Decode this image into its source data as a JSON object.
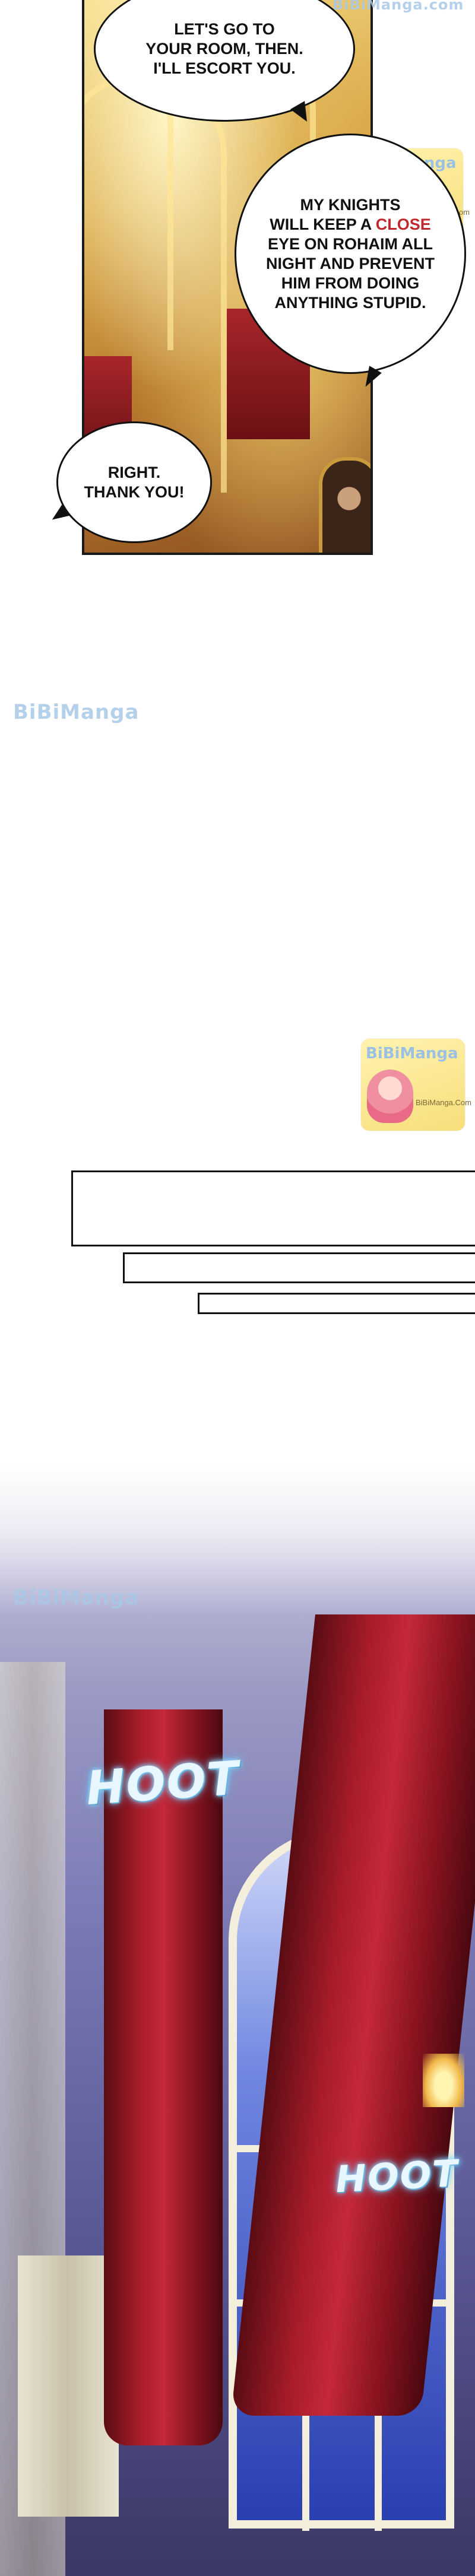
{
  "watermark": {
    "top_right": "BiBiManga.com",
    "mid_left": "BiBiManga",
    "badge_title": "BiBiManga",
    "badge_sub": "BiBiManga.Com",
    "bottom_left": "BiBiManga",
    "small_badge_title": "BiBiManga",
    "small_badge_sub": "BiBiManga.Com"
  },
  "bubbles": {
    "escort": "LET'S GO TO\nYOUR ROOM, THEN.\nI'LL ESCORT YOU.",
    "knights_pre": "MY KNIGHTS\nWILL KEEP A ",
    "knights_red": "CLOSE",
    "knights_post": "\nEYE ON ROHAIM ALL\nNIGHT AND PREVENT\nHIM FROM DOING\nANYTHING STUPID.",
    "thanks": "RIGHT.\nTHANK YOU!"
  },
  "sfx": {
    "hoot_1": "HOOT",
    "hoot_2": "HOOT"
  },
  "colors": {
    "emphasis": "#c0282d",
    "sfx_glow": "#5fc8ff"
  }
}
